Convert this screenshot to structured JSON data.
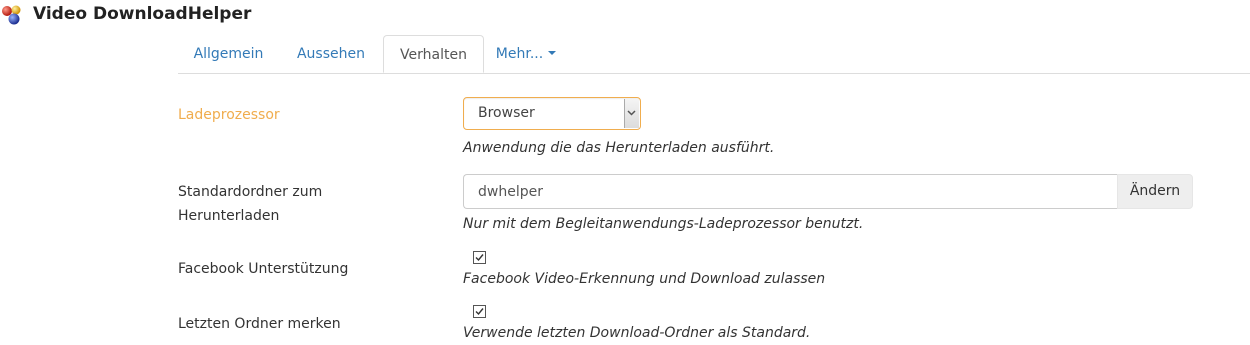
{
  "app": {
    "title": "Video DownloadHelper",
    "logo_icon": "three-spheres-logo"
  },
  "tabs": [
    {
      "label": "Allgemein",
      "active": false
    },
    {
      "label": "Aussehen",
      "active": false
    },
    {
      "label": "Verhalten",
      "active": true
    },
    {
      "label": "Mehr...",
      "active": false,
      "dropdown": true
    }
  ],
  "settings": {
    "processor": {
      "label": "Ladeprozessor",
      "value": "Browser",
      "help": "Anwendung die das Herunterladen ausführt."
    },
    "default_folder": {
      "label_line1": "Standardordner zum",
      "label_line2": "Herunterladen",
      "value": "dwhelper",
      "button": "Ändern",
      "help": "Nur mit dem Begleitanwendungs-Ladeprozessor benutzt."
    },
    "facebook": {
      "label": "Facebook Unterstützung",
      "checked": true,
      "help": "Facebook Video-Erkennung und Download zulassen"
    },
    "last_folder": {
      "label": "Letzten Ordner merken",
      "checked": true,
      "help": "Verwende letzten Download-Ordner als Standard."
    }
  },
  "colors": {
    "accent": "#337ab7",
    "warning": "#f0ad4e",
    "text": "#333333"
  }
}
